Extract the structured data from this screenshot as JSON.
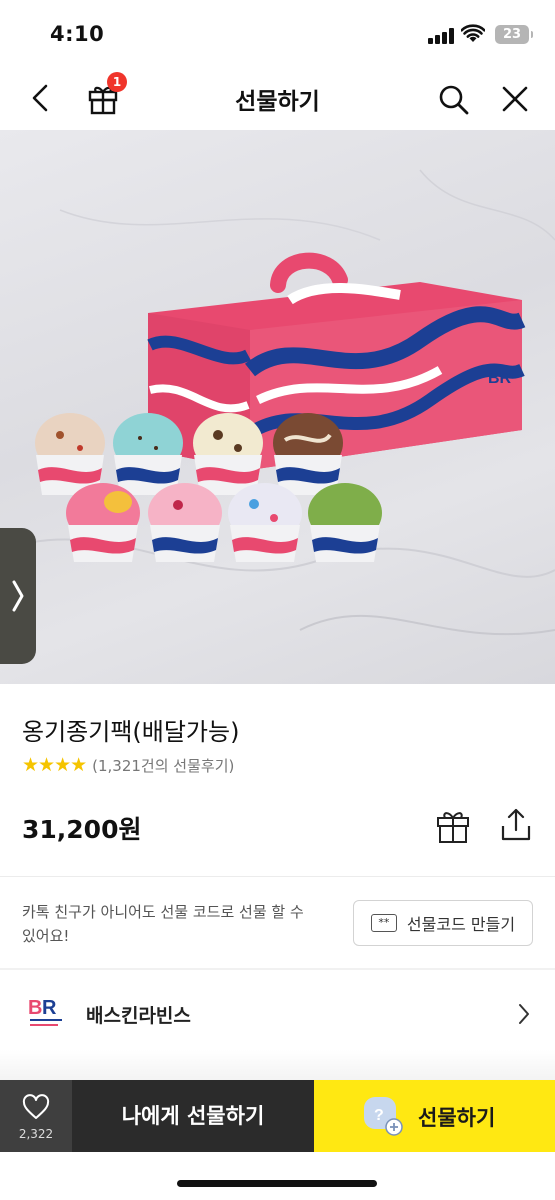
{
  "status_bar": {
    "time": "4:10",
    "battery": "23"
  },
  "nav": {
    "title": "선물하기",
    "gift_badge": "1"
  },
  "product": {
    "name": "옹기종기팩(배달가능)",
    "stars": "★★★★",
    "reviews": "(1,321건의 선물후기)",
    "price": "31,200원"
  },
  "gift_code": {
    "description": "카톡 친구가 아니어도 선물 코드로 선물 할 수 있어요!",
    "button_label": "선물코드 만들기",
    "button_icon_text": "**"
  },
  "brand": {
    "name": "배스킨라빈스",
    "logo_text": "BR"
  },
  "bottom_bar": {
    "like_count": "2,322",
    "self_gift_label": "나에게 선물하기",
    "gift_label": "선물하기"
  },
  "colors": {
    "accent_yellow": "#ffe812",
    "badge_red": "#f0352b",
    "box_pink": "#e8496f",
    "brand_blue": "#1c3f94",
    "dark_button": "#2b2b2b"
  }
}
